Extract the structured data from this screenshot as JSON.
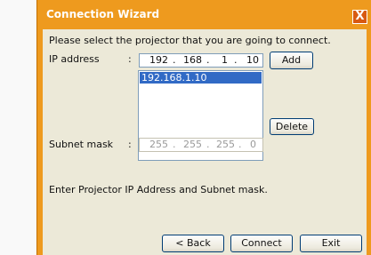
{
  "dialog": {
    "title": "Connection Wizard",
    "close_glyph": "X",
    "instruction": "Please select the projector that you are going to connect.",
    "help_text": "Enter Projector IP Address and Subnet mask."
  },
  "ip": {
    "label": "IP address",
    "colon": ":",
    "octets": [
      "192",
      "168",
      "1",
      "10"
    ],
    "dot": ".",
    "add_label": "Add"
  },
  "list": {
    "items": [
      "192.168.1.10"
    ],
    "delete_label": "Delete"
  },
  "subnet": {
    "label": "Subnet mask",
    "colon": ":",
    "octets": [
      "255",
      "255",
      "255",
      "0"
    ],
    "dot": "."
  },
  "footer": {
    "back_label": "< Back",
    "connect_label": "Connect",
    "exit_label": "Exit"
  },
  "colors": {
    "frame": "#ee9a1e",
    "client": "#ece9d8",
    "selection": "#316ac5"
  }
}
